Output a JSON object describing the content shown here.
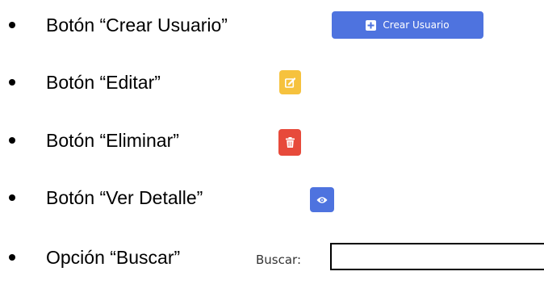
{
  "items": [
    {
      "label": "Botón “Crear Usuario”",
      "button_text": "Crear Usuario",
      "icon": "plus-square-icon",
      "color": "#4e73df"
    },
    {
      "label": "Botón “Editar”",
      "icon": "edit-icon",
      "color": "#f6c23e"
    },
    {
      "label": "Botón “Eliminar”",
      "icon": "trash-icon",
      "color": "#e74a3b"
    },
    {
      "label": "Botón “Ver Detalle”",
      "icon": "eye-icon",
      "color": "#4e73df"
    },
    {
      "label": "Opción “Buscar”",
      "search_label": "Buscar:",
      "search_value": ""
    }
  ]
}
